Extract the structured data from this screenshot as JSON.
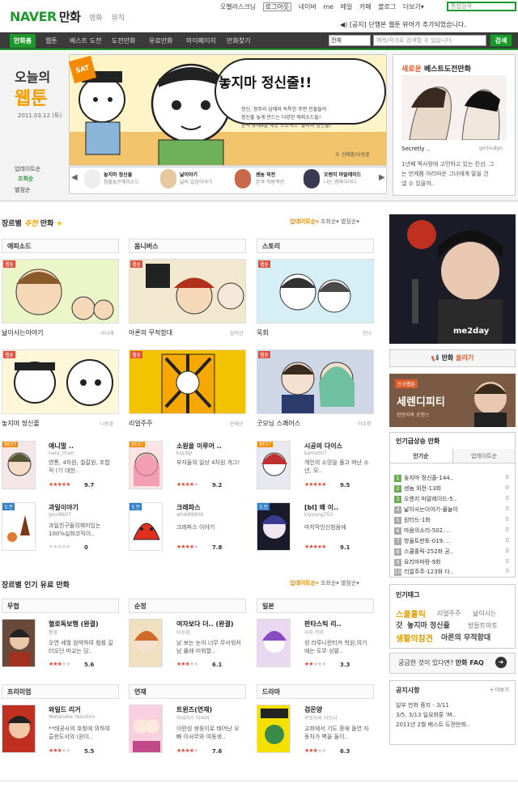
{
  "header": {
    "logo": "NAVER",
    "logo_sub": "만화",
    "nav": [
      "영화",
      "뮤직"
    ],
    "top_links": [
      "오벨러스크님",
      "로그아웃",
      "네이버",
      "me",
      "메일",
      "카페",
      "블로그",
      "더보기▾"
    ],
    "top_search_placeholder": "통합검색",
    "notice": "[공지] 단행본 웹툰 뷰어가 추가되었습니다."
  },
  "navbar": {
    "items": [
      "만화홈",
      "웹툰",
      "베스트 도전",
      "도전만화",
      "유료만화",
      "마이페이지",
      "만화찾기"
    ],
    "select": "전체",
    "search_placeholder": "제목/작가로 검색할 수 있습니다.",
    "search_btn": "검색"
  },
  "hero": {
    "left_title1": "오늘의",
    "left_title2": "웹툰",
    "date": "2011.03.12 (토)",
    "left_menu": [
      "업데이트순",
      "조회순",
      "별점순"
    ],
    "day_badge": "SAT",
    "banner_title": "놓지마 정신줄!!",
    "banner_desc": [
      "정신, 정주리 남매와 독특한 주변 인물들의",
      "정신줄 놓게 만드는 다양한 에피소드들!",
      "본격 유쾌9발 해방 프로젝트 '놓지마 정신줄!'"
    ],
    "banner_author": "© 신태훈/나승훈",
    "strip": [
      {
        "title": "놓지마 정신줄",
        "desc": "정줄놓은에피소드"
      },
      {
        "title": "낢이야기",
        "desc": "낢의 일상이야기"
      },
      {
        "title": "센놈 외전",
        "desc": "본격 학원액션"
      },
      {
        "title": "오렌지 마말레이드",
        "desc": "나는 뱀파이어다"
      }
    ],
    "right_title_new": "새로운",
    "right_title": "베스트도전만화",
    "right_name": "Secretly ..",
    "right_author": "gmlrudgn",
    "right_desc": [
      "1년째 짝사랑에 고민하고 있는 진선. 그",
      "는 언제쯤 아리따운 그녀에게 말을 건",
      "낼 수 있을까.."
    ]
  },
  "genre": {
    "title_pre": "장르별",
    "title_hl": "추천",
    "title_post": "만화",
    "sort": [
      "업데이트순▾",
      "조회순▾",
      "별점순▾"
    ],
    "cats": [
      "에피소드",
      "옴니버스",
      "스토리"
    ],
    "big": [
      {
        "title": "낢이사는이야기",
        "author": "서나래",
        "badge": "웹툰"
      },
      {
        "title": "아론의 무적함대",
        "author": "김미선",
        "badge": "웹툰"
      },
      {
        "title": "묵회",
        "author": "한나",
        "badge": "웹툰"
      },
      {
        "title": "놓지마 정신줄",
        "author": "나승훈",
        "badge": "웹툰"
      },
      {
        "title": "리얼주주",
        "author": "순태규",
        "badge": "웹툰"
      },
      {
        "title": "굿모닝 스쾌어스",
        "author": "이수정",
        "badge": "웹툰"
      }
    ],
    "small": [
      {
        "title": "애니멀 ..",
        "author": "nara_chan",
        "desc": "영통, 4차원, 칠갈원, 조합적 (?) 대한..",
        "rating": "9.7",
        "stars": 5,
        "badge": "BEST"
      },
      {
        "title": "소원을 이루어 ..",
        "author": "kss3gr",
        "desc": "부자들의 일상 4차원 개그!",
        "rating": "9.2",
        "stars": 4,
        "badge": "BEST"
      },
      {
        "title": "시공의 다이스",
        "author": "kamo007",
        "desc": "개인의 소망을 풀고 떠난 소년, 모..",
        "rating": "9.5",
        "stars": 5,
        "badge": "BEST"
      },
      {
        "title": "과일이야기",
        "author": "govi8607",
        "desc": "과일친구들의재미있는100%실화코믹이..",
        "rating": "0",
        "stars": 0,
        "badge": "도전"
      },
      {
        "title": "크레파스",
        "author": "whddl9906",
        "desc": "크레파스 이야기",
        "rating": "7.8",
        "stars": 4,
        "badge": "도전"
      },
      {
        "title": "[bl] 왜 이..",
        "author": "kiyoung753",
        "desc": "마치막인신밤음에",
        "rating": "9.1",
        "stars": 5,
        "badge": "도전"
      }
    ]
  },
  "paid": {
    "title": "장르별 인기 유료 만화",
    "sort": [
      "업데이트순▾",
      "조회순▾",
      "별점순▾"
    ],
    "cats": [
      "무협",
      "순정",
      "일본",
      "프리미엄",
      "연재",
      "드라마"
    ],
    "items": [
      {
        "title": "혈로독보행 (완결)",
        "author": "풍영",
        "desc": "오연 세월 암약하여 힘를 길러오던 마교는 당..",
        "rating": "5.6",
        "stars": 3
      },
      {
        "title": "여자보다 더.. (완결)",
        "author": "이수희",
        "desc": "남 보는 눈이 너무 무서워서 남 몰래 미워할..",
        "rating": "6.1",
        "stars": 3
      },
      {
        "title": "판타스틱 리..",
        "author": "사자 키미",
        "desc": "성 라루니란티카 학원,여기에는 도무 상황..",
        "rating": "3.3",
        "stars": 2
      },
      {
        "title": "와일드 리거",
        "author": "Watanabe Yasuhiro",
        "desc": "**태공사의 호칭에 의하여 출판도서의 (원이..",
        "rating": "5.5",
        "stars": 3
      },
      {
        "title": "트윈즈(연재)",
        "author": "하네카기 마이비",
        "desc": "이란성 쌍둥이로 태어난 오빠 이사무와 여동생..",
        "rating": "7.6",
        "stars": 4
      },
      {
        "title": "검은양",
        "author": "쿠로카와 아즈사",
        "desc": "교회에서 기도 중에 돌연 자동차가 벽을 들이..",
        "rating": "6.3",
        "stars": 3
      }
    ]
  },
  "right": {
    "ad_text": "me2day",
    "upload_btn_red": "만화",
    "upload_btn": "올리기",
    "new_badge": "신규웹툰",
    "new_title": "세렌디피티",
    "new_sub": "천방지축 로맨스",
    "rank_title": "인기급상승 만화",
    "rank_tabs": [
      "인기순",
      "업데이트순"
    ],
    "rank": [
      {
        "n": "1",
        "t": "놓지마 정신줄-144.."
      },
      {
        "n": "2",
        "t": "센놈 외전-13화"
      },
      {
        "n": "3",
        "t": "오렌지 마말레이드-5.."
      },
      {
        "n": "4",
        "t": "낢이사는이야기-물놀이"
      },
      {
        "n": "5",
        "t": "원터드-1화"
      },
      {
        "n": "6",
        "t": "마음의소리-502. .."
      },
      {
        "n": "7",
        "t": "방들트만토-019. .."
      },
      {
        "n": "8",
        "t": "스쿨홀릭-252화 공.."
      },
      {
        "n": "9",
        "t": "요리마마랑-9화"
      },
      {
        "n": "10",
        "t": "리얼주주-123화 다.."
      }
    ],
    "rank_change": "0",
    "tag_title": "인기태그",
    "tags": [
      "스쿨홀릭",
      "리얼주주",
      "낢이사는",
      "갓",
      "놓지마 정신줄",
      "방들트마토",
      "생활의참견",
      "아론의 무적함대"
    ],
    "faq_text": "궁금한 것이 있다면?",
    "faq_bold": "만화 FAQ",
    "notice_title": "공지사항",
    "notice_more": "+ 더보기",
    "notices": [
      "일부 만화 중지 - 3/11",
      "3/5, 3/13 일요화툰 'M..",
      "2011년 2월 베스트 도전만화.."
    ]
  }
}
